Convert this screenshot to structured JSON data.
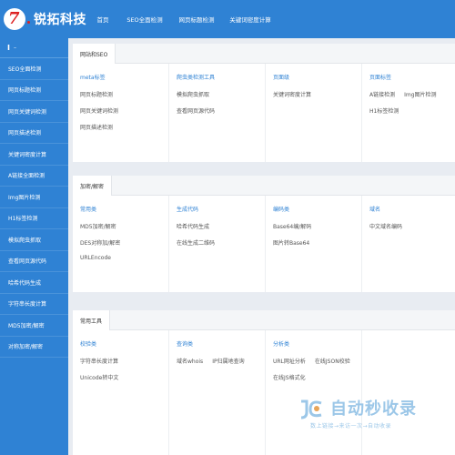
{
  "brand": {
    "name": "锐拓科技",
    "logo_glyph": "7"
  },
  "topnav": [
    "首页",
    "SEO全面检测",
    "网页标题检测",
    "关键词密度计算"
  ],
  "sidebar": {
    "header": "I",
    "header_dash": "–",
    "items": [
      "SEO全面检测",
      "网页标题检测",
      "网页关键词检测",
      "网页描述检测",
      "关键词密度计算",
      "A链接全面检测",
      "Img图片检测",
      "H1标签检测",
      "模拟爬虫抓取",
      "查看网页源代码",
      "哈希代码生成",
      "字符串长度计算",
      "MD5加密/解密",
      "对称加密/解密"
    ]
  },
  "panels": [
    {
      "tab": "网站和SEO",
      "cols": [
        {
          "title": "meta标签",
          "links": [
            "网页标题检测",
            "网页关键词检测",
            "网页描述检测"
          ]
        },
        {
          "title": "爬虫类检测工具",
          "links": [
            "模拟爬虫抓取",
            "查看网页源代码"
          ]
        },
        {
          "title": "页面级",
          "links": [
            "关键词密度计算"
          ]
        },
        {
          "title": "页面标签",
          "links": [
            "A链接检测",
            "Img图片检测",
            "H1标签检测"
          ]
        }
      ]
    },
    {
      "tab": "加密/解密",
      "cols": [
        {
          "title": "常用类",
          "links": [
            "MD5加密/解密",
            "DES对称加/解密",
            "URLEncode"
          ]
        },
        {
          "title": "生成代码",
          "links": [
            "哈希代码生成",
            "在线生成二维码"
          ]
        },
        {
          "title": "编码类",
          "links": [
            "Base64编/解码",
            "图片转Base64"
          ]
        },
        {
          "title": "域名",
          "links": [
            "中文域名编码"
          ]
        }
      ]
    },
    {
      "tab": "常用工具",
      "cols": [
        {
          "title": "校验类",
          "links": [
            "字符串长度计算",
            "Unicode转中文"
          ]
        },
        {
          "title": "查询类",
          "links": [
            "域名whois",
            "IP归属地查询"
          ]
        },
        {
          "title": "分析类",
          "links": [
            "URL网址分析",
            "在线JSON校验",
            "在线JS格式化"
          ]
        },
        {
          "title": "",
          "links": []
        }
      ]
    }
  ],
  "watermark": {
    "title": "自动秒收录",
    "subtitle": "数上链接→来访一次→自动收录",
    "mark": "JC"
  },
  "colors": {
    "primary": "#2f82d4",
    "link_title": "#2f82d4",
    "background": "#e8ecf2",
    "logo_red": "#dd2222"
  }
}
